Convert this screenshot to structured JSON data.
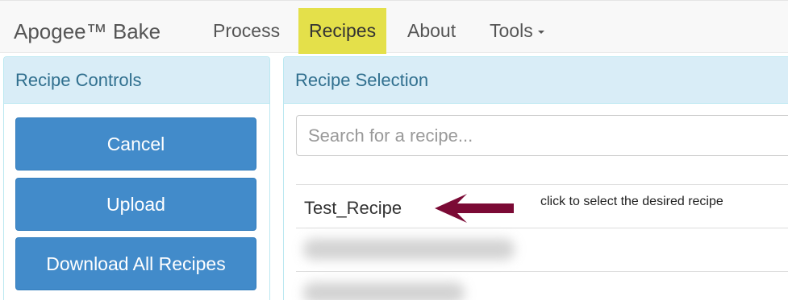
{
  "navbar": {
    "brand": "Apogee™ Bake",
    "items": [
      {
        "label": "Process"
      },
      {
        "label": "Recipes"
      },
      {
        "label": "About"
      },
      {
        "label": "Tools"
      }
    ]
  },
  "recipe_controls": {
    "title": "Recipe Controls",
    "buttons": [
      {
        "label": "Cancel"
      },
      {
        "label": "Upload"
      },
      {
        "label": "Download All Recipes"
      }
    ]
  },
  "recipe_selection": {
    "title": "Recipe Selection",
    "search_placeholder": "Search for a recipe...",
    "recipes": [
      {
        "label": "Test_Recipe"
      }
    ],
    "annotation": "click to select the desired recipe"
  },
  "colors": {
    "active_nav": "#e4e04a",
    "primary_button": "#428bca",
    "panel_heading": "#d9edf7",
    "arrow": "#7b0a35"
  }
}
